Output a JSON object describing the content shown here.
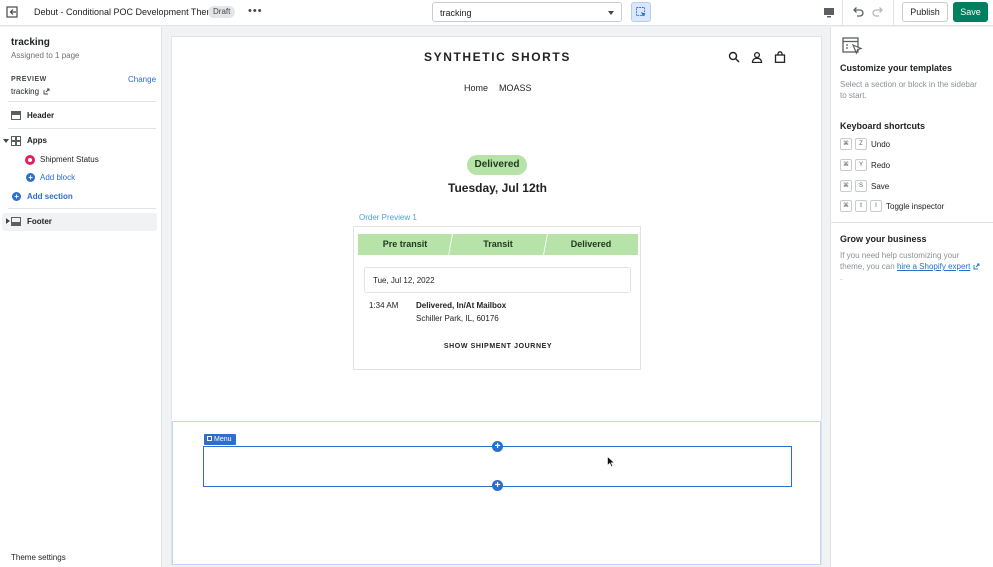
{
  "topbar": {
    "theme_name": "Debut - Conditional POC Development Theme",
    "status_badge": "Draft",
    "more_label": "•••",
    "template_select": "tracking",
    "publish_label": "Publish",
    "save_label": "Save"
  },
  "sidebar": {
    "page_title": "tracking",
    "assigned": "Assigned to 1 page",
    "preview_label": "PREVIEW",
    "change_label": "Change",
    "preview_value": "tracking",
    "sections": {
      "header": "Header",
      "apps": "Apps",
      "shipment_status": "Shipment Status",
      "add_block": "Add block",
      "add_section": "Add section",
      "footer": "Footer"
    },
    "theme_settings": "Theme settings"
  },
  "preview": {
    "store_name": "SYNTHETIC SHORTS",
    "nav": [
      "Home",
      "MOASS"
    ],
    "status_pill": "Delivered",
    "delivery_date": "Tuesday, Jul 12th",
    "order_preview": "Order Preview 1",
    "steps": [
      "Pre transit",
      "Transit",
      "Delivered"
    ],
    "event_date": "Tue, Jul 12, 2022",
    "event_time": "1:34 AM",
    "event_status": "Delivered, In/At Mailbox",
    "event_location": "Schiller Park, IL, 60176",
    "journey_link": "SHOW SHIPMENT JOURNEY",
    "menu_tag": "Menu"
  },
  "inspector": {
    "customize_title": "Customize your templates",
    "customize_desc": "Select a section or block in the sidebar to start.",
    "shortcuts_title": "Keyboard shortcuts",
    "shortcuts": [
      {
        "keys": [
          "⌘",
          "Z"
        ],
        "label": "Undo"
      },
      {
        "keys": [
          "⌘",
          "Y"
        ],
        "label": "Redo"
      },
      {
        "keys": [
          "⌘",
          "S"
        ],
        "label": "Save"
      },
      {
        "keys": [
          "⌘",
          "⇧",
          "I"
        ],
        "label": "Toggle inspector"
      }
    ],
    "grow_title": "Grow your business",
    "grow_desc": "If you need help customizing your theme, you can",
    "grow_link": "hire a Shopify expert",
    "grow_end": "."
  },
  "colors": {
    "accent": "#2c6ecb",
    "save_button": "#008060",
    "status_green": "#b7e3a8"
  }
}
